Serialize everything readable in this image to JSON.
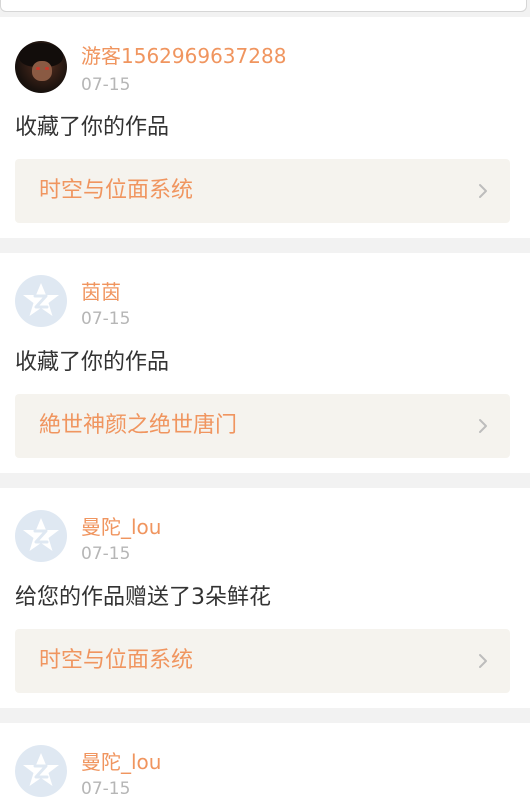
{
  "notifications": [
    {
      "avatar_type": "photo",
      "avatar_icon": "user-photo-avatar",
      "username": "游客1562969637288",
      "date": "07-15",
      "action": "收藏了你的作品",
      "work_title": "时空与位面系统"
    },
    {
      "avatar_type": "default",
      "avatar_icon": "default-avatar-icon",
      "username": "茵茵",
      "date": "07-15",
      "action": "收藏了你的作品",
      "work_title": "絶世神颜之绝世唐门"
    },
    {
      "avatar_type": "default",
      "avatar_icon": "default-avatar-icon",
      "username": "曼陀_lou",
      "date": "07-15",
      "action": "给您的作品赠送了3朵鲜花",
      "work_title": "时空与位面系统"
    },
    {
      "avatar_type": "default",
      "avatar_icon": "default-avatar-icon",
      "username": "曼陀_lou",
      "date": "07-15"
    }
  ],
  "colors": {
    "accent": "#f0955f",
    "date_gray": "#b6b6b6",
    "text_dark": "#333333",
    "work_box_bg": "#f5f3ee",
    "page_bg": "#f2f2f2",
    "default_avatar_bg": "#dfe8f2",
    "default_avatar_star": "#ffffff"
  }
}
